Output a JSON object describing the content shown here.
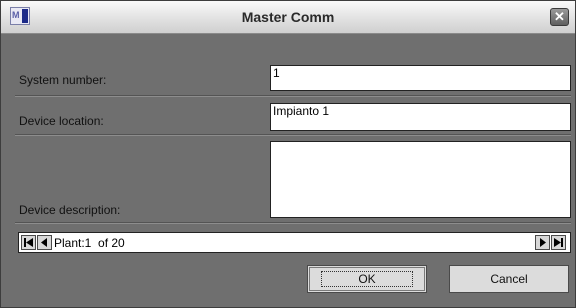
{
  "window": {
    "title": "Master Comm",
    "app_icon": "mc-app-icon",
    "close_icon": "close-icon"
  },
  "form": {
    "system_number": {
      "label": "System number:",
      "value": "1"
    },
    "device_location": {
      "label": "Device location:",
      "value": "Impianto 1"
    },
    "device_description": {
      "label": "Device description:",
      "value": ""
    }
  },
  "navigator": {
    "text": "Plant:1  of 20"
  },
  "buttons": {
    "ok": "OK",
    "cancel": "Cancel"
  }
}
